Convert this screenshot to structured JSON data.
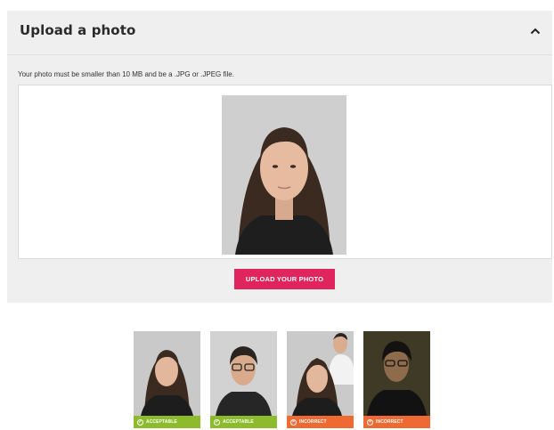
{
  "panel": {
    "title": "Upload a photo",
    "collapse_icon": "chevron-up-icon",
    "instructions": "Your photo must be smaller than 10 MB and be a .JPG or .JPEG file.",
    "upload_button_label": "UPLOAD YOUR PHOTO"
  },
  "examples": [
    {
      "status": "ACCEPTABLE",
      "icon": "check-circle-icon"
    },
    {
      "status": "ACCEPTABLE",
      "icon": "check-circle-icon"
    },
    {
      "status": "INCORRECT",
      "icon": "x-circle-icon"
    },
    {
      "status": "INCORRECT",
      "icon": "x-circle-icon"
    }
  ],
  "colors": {
    "accent": "#e0245e",
    "acceptable": "#8cbb2c",
    "incorrect": "#ef6a32",
    "panel_bg": "#efefef"
  }
}
